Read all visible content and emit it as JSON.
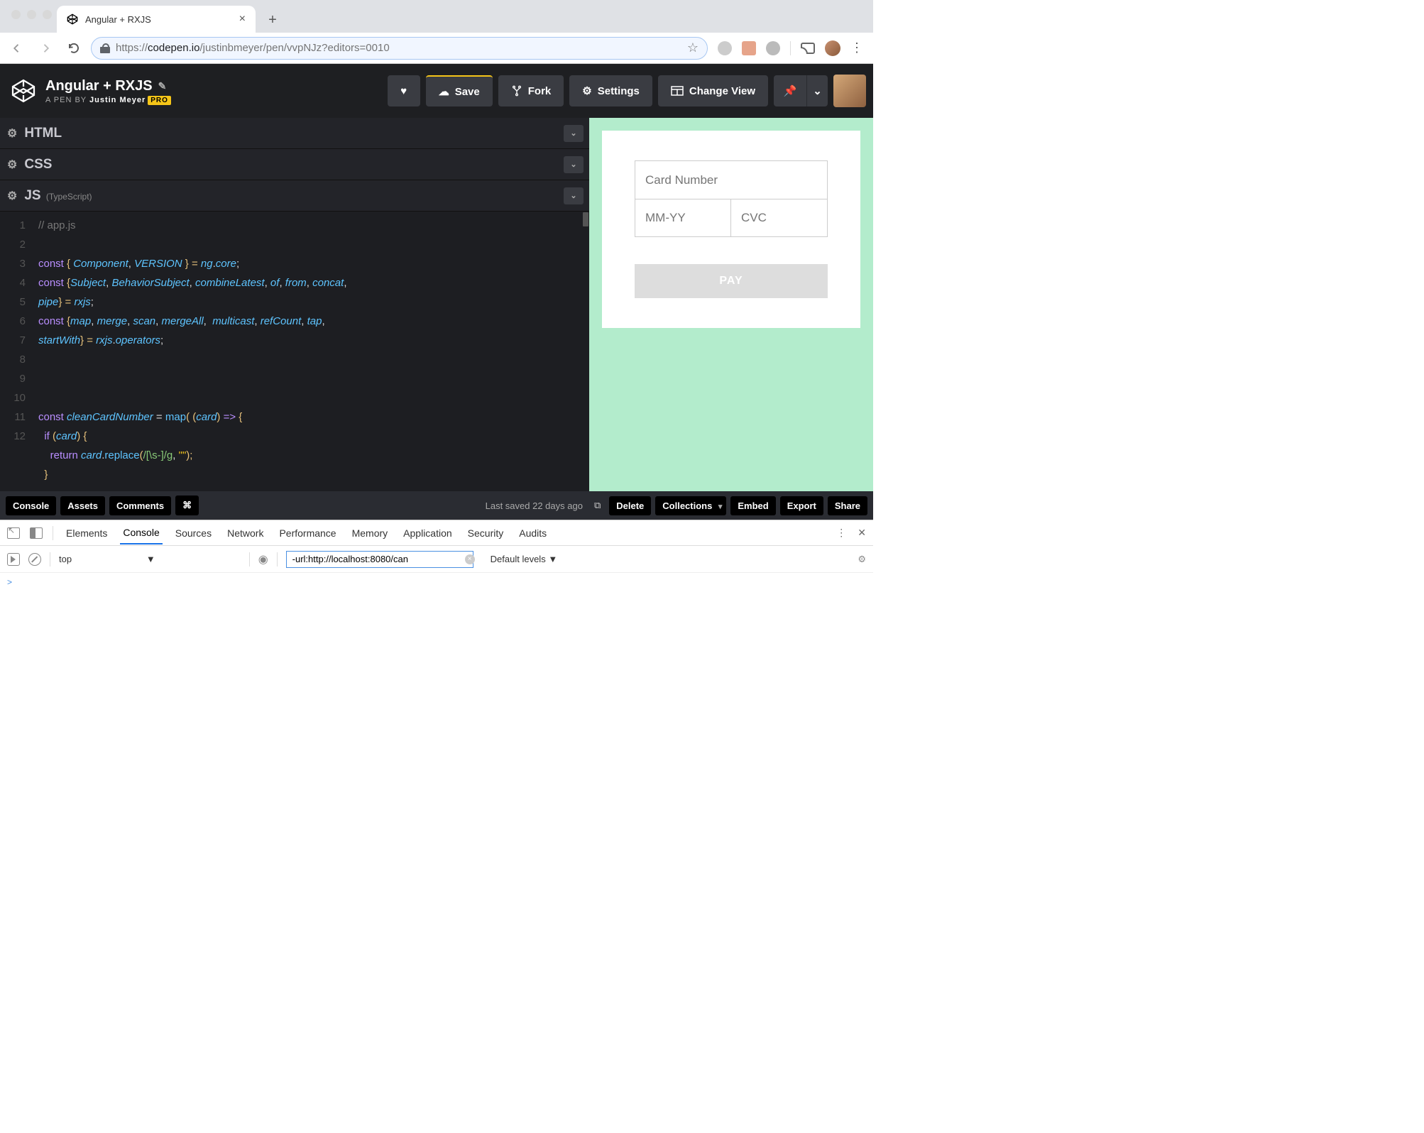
{
  "browser": {
    "tab_title": "Angular + RXJS",
    "url_prefix": "https://",
    "url_host": "codepen.io",
    "url_path": "/justinbmeyer/pen/vvpNJz?editors=0010"
  },
  "codepen": {
    "title": "Angular + RXJS",
    "subtitle_prefix": "A PEN BY ",
    "author": "Justin Meyer",
    "pro_badge": "PRO",
    "buttons": {
      "save": "Save",
      "fork": "Fork",
      "settings": "Settings",
      "change_view": "Change View"
    },
    "panels": {
      "html": "HTML",
      "css": "CSS",
      "js": "JS",
      "js_lang": "(TypeScript)"
    },
    "code": {
      "lines": [
        "1",
        "2",
        "3",
        "4",
        "5",
        "6",
        "7",
        "8",
        "9",
        "10",
        "11",
        "12"
      ]
    },
    "preview": {
      "card_number": "Card Number",
      "mmyy": "MM-YY",
      "cvc": "CVC",
      "pay": "PAY"
    },
    "footer": {
      "console": "Console",
      "assets": "Assets",
      "comments": "Comments",
      "shortcut": "⌘",
      "last_saved": "Last saved 22 days ago",
      "delete": "Delete",
      "collections": "Collections",
      "embed": "Embed",
      "export": "Export",
      "share": "Share"
    }
  },
  "devtools": {
    "tabs": [
      "Elements",
      "Console",
      "Sources",
      "Network",
      "Performance",
      "Memory",
      "Application",
      "Security",
      "Audits"
    ],
    "context": "top",
    "filter": "-url:http://localhost:8080/can",
    "levels": "Default levels",
    "prompt": ">"
  },
  "code_tokens": {
    "l1": "// app.js",
    "const": "const",
    "l3_a": "{ ",
    "l3_ids": "Component",
    "l3_c": ", ",
    "l3_ver": "VERSION",
    "l3_b": " } = ",
    "l3_ng": "ng",
    "l3_d": ".",
    "l3_core": "core",
    "l3_e": ";",
    "l4_a": "{",
    "l4_s": "Subject",
    "l4_c1": ", ",
    "l4_bs": "BehaviorSubject",
    "l4_c2": ", ",
    "l4_cl": "combineLatest",
    "l4_c3": ", ",
    "l4_of": "of",
    "l4_c4": ", ",
    "l4_from": "from",
    "l4_c5": ", ",
    "l4_concat": "concat",
    "l4_c6": ",",
    "l4b_pipe": "pipe",
    "l4b_b": "} = ",
    "l4b_rx": "rxjs",
    "l4b_e": ";",
    "l5_a": "{",
    "l5_map": "map",
    "l5_c1": ", ",
    "l5_merge": "merge",
    "l5_c2": ", ",
    "l5_scan": "scan",
    "l5_c3": ", ",
    "l5_ma": "mergeAll",
    "l5_c4": ",  ",
    "l5_mc": "multicast",
    "l5_c5": ", ",
    "l5_rc": "refCount",
    "l5_c6": ", ",
    "l5_tap": "tap",
    "l5_c7": ",",
    "l5b_sw": "startWith",
    "l5b_b": "} = ",
    "l5b_rx": "rxjs",
    "l5b_d": ".",
    "l5b_op": "operators",
    "l5b_e": ";",
    "l9_name": "cleanCardNumber",
    "l9_eq": " = ",
    "l9_map": "map",
    "l9_p1": "( (",
    "l9_card": "card",
    "l9_p2": ") ",
    "l9_arrow": "=>",
    "l9_p3": " {",
    "l10_if": "if",
    "l10_p1": " (",
    "l10_card": "card",
    "l10_p2": ") {",
    "l11_ret": "return",
    "l11_sp": " ",
    "l11_card": "card",
    "l11_d": ".",
    "l11_repl": "replace",
    "l11_p1": "(",
    "l11_rx": "/[\\s-]/g",
    "l11_c": ", ",
    "l11_str": "\"\"",
    "l11_p2": ");",
    "l12": "}"
  }
}
